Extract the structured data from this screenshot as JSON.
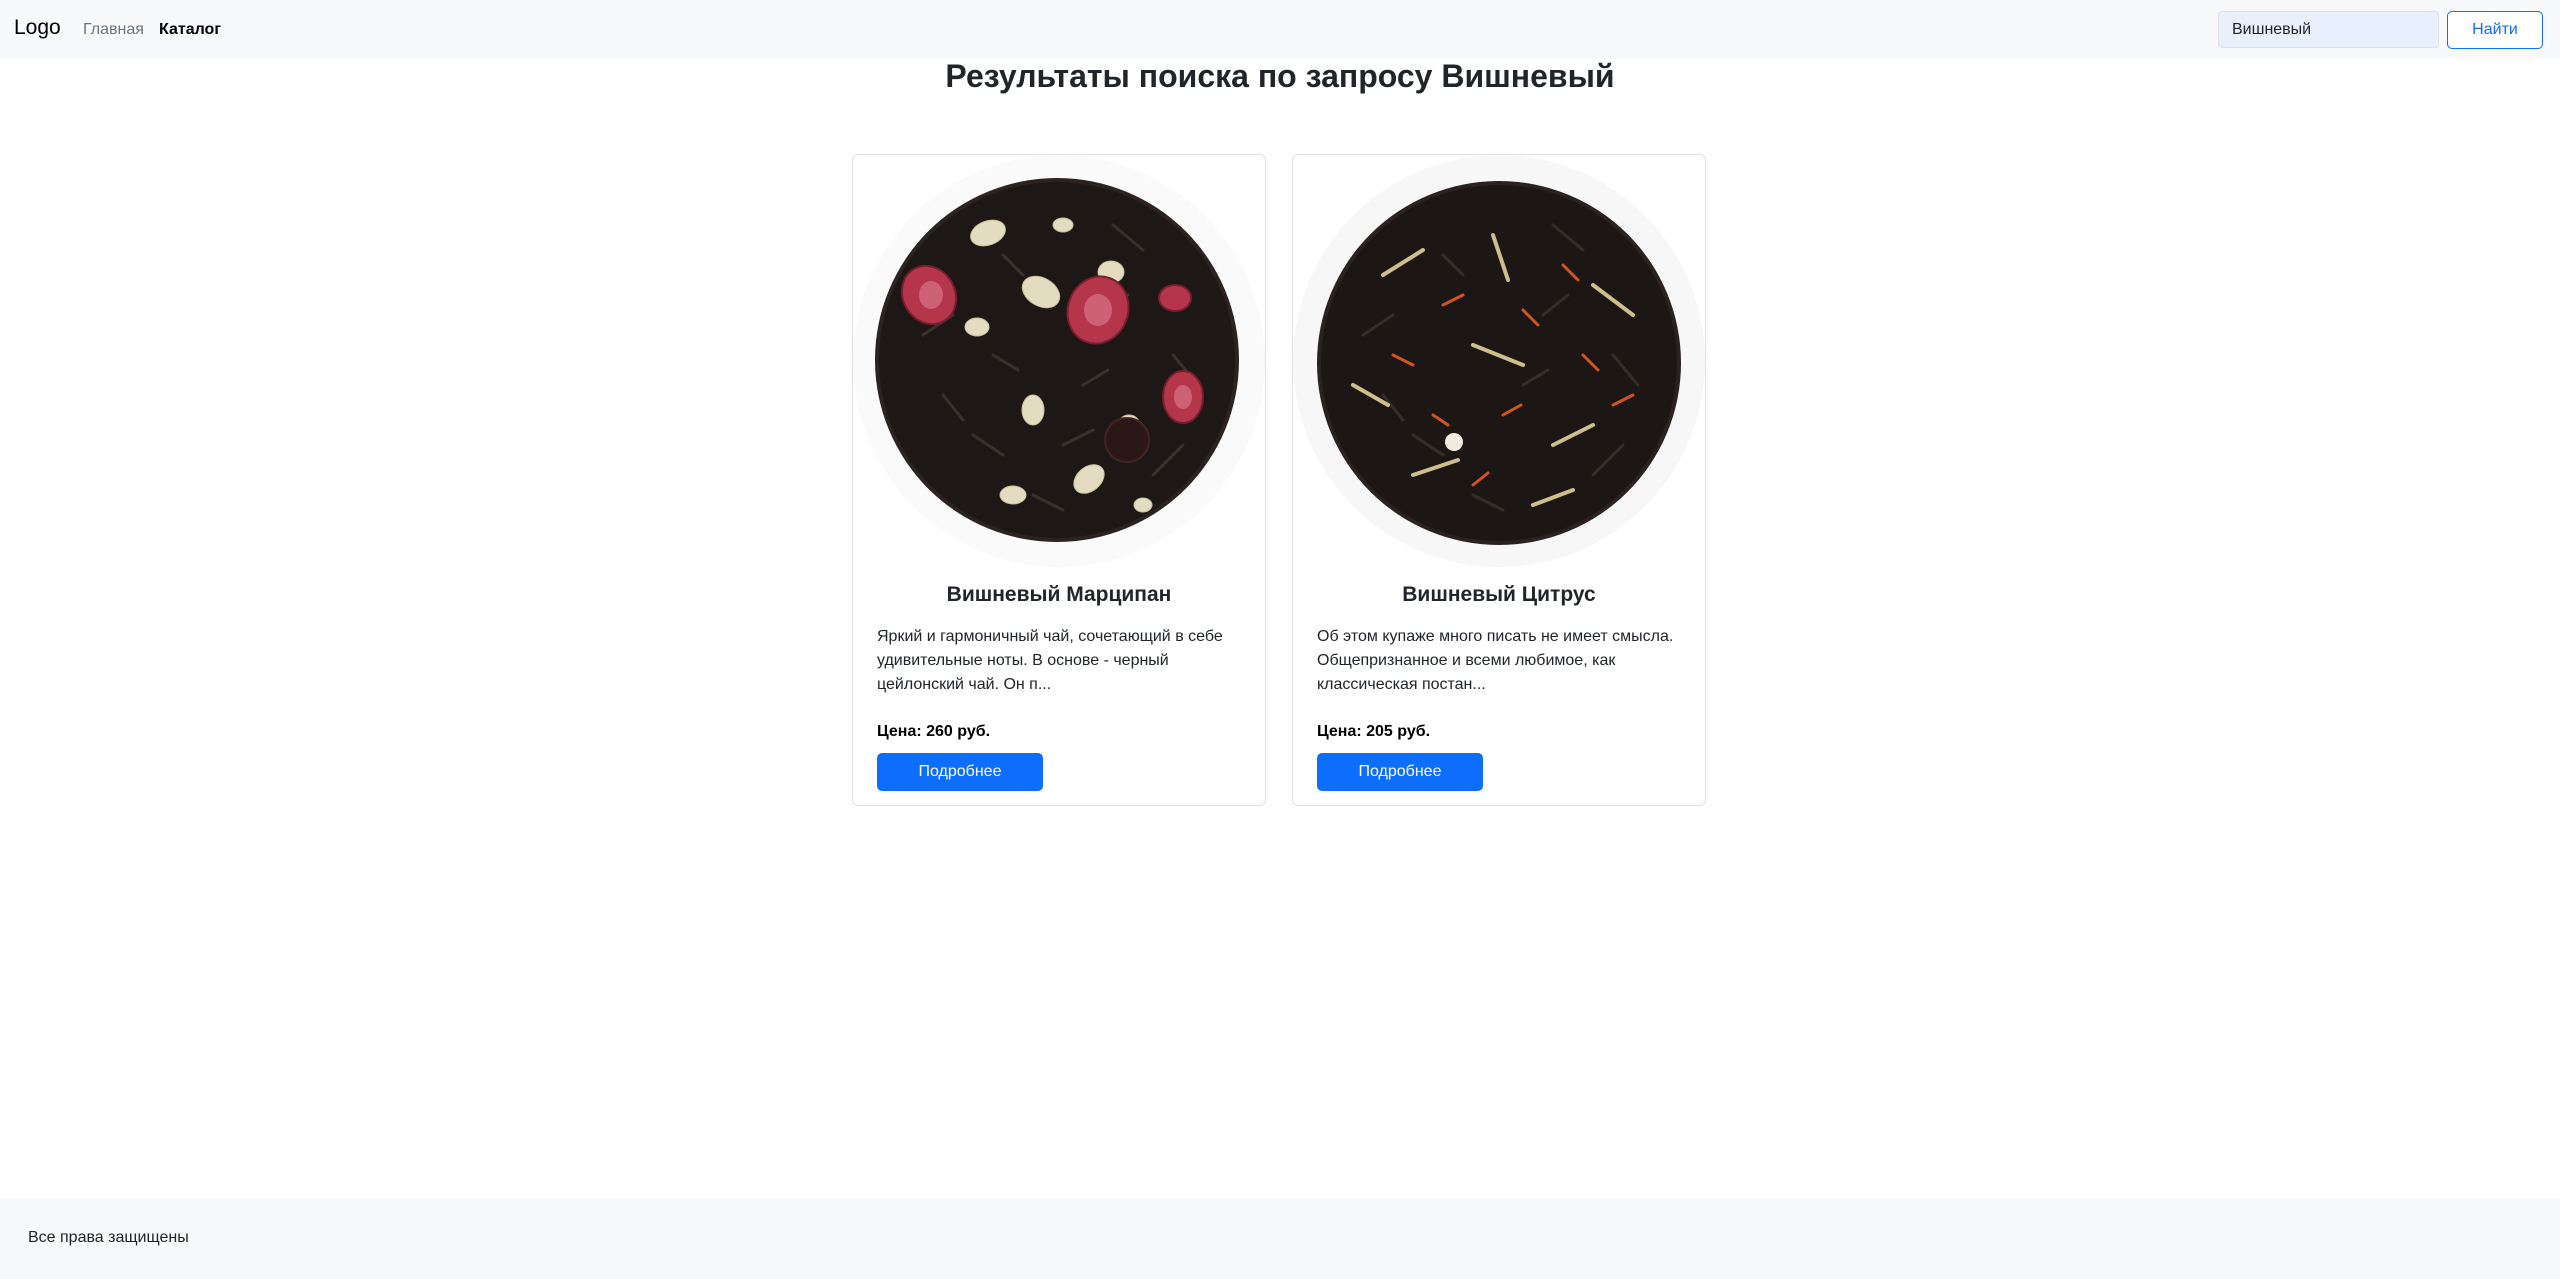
{
  "navbar": {
    "brand": "Logo",
    "links": [
      {
        "label": "Главная",
        "active": false
      },
      {
        "label": "Каталог",
        "active": true
      }
    ],
    "search": {
      "value": "Вишневый",
      "button_label": "Найти"
    }
  },
  "page": {
    "title": "Результаты поиска по запросу Вишневый"
  },
  "products": [
    {
      "name": "Вишневый Марципан",
      "description": "Яркий и гармоничный чай, сочетающий в себе удивительные ноты. В основе - черный цейлонский чай. Он п...",
      "price": "Цена: 260 руб.",
      "button_label": "Подробнее"
    },
    {
      "name": "Вишневый Цитрус",
      "description": "Об этом купаже много писать не имеет смысла. Общепризнанное и всеми любимое, как классическая постан...",
      "price": "Цена: 205 руб.",
      "button_label": "Подробнее"
    }
  ],
  "footer": {
    "text": "Все права защищены"
  },
  "colors": {
    "primary": "#0d6efd",
    "navbar_bg": "#f8f9fa",
    "muted": "#6c757d"
  }
}
